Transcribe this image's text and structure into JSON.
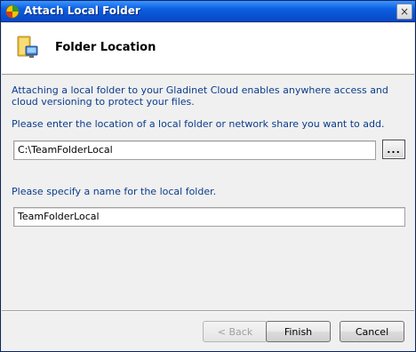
{
  "window": {
    "title": "Attach Local Folder",
    "close_glyph": "×"
  },
  "header": {
    "title": "Folder Location",
    "icon": "folder-computer-icon"
  },
  "content": {
    "description": "Attaching a local folder to your Gladinet Cloud enables anywhere access and cloud versioning to protect your files.",
    "location_prompt": "Please enter the location of a local folder or network share you want to add.",
    "location_value": "C:\\TeamFolderLocal",
    "browse_label": "...",
    "name_prompt": "Please specify a name for the local folder.",
    "name_value": "TeamFolderLocal"
  },
  "footer": {
    "back_label": "< Back",
    "finish_label": "Finish",
    "cancel_label": "Cancel"
  },
  "colors": {
    "titlebar": "#0a5fe0",
    "label_text": "#0b3c8c"
  }
}
